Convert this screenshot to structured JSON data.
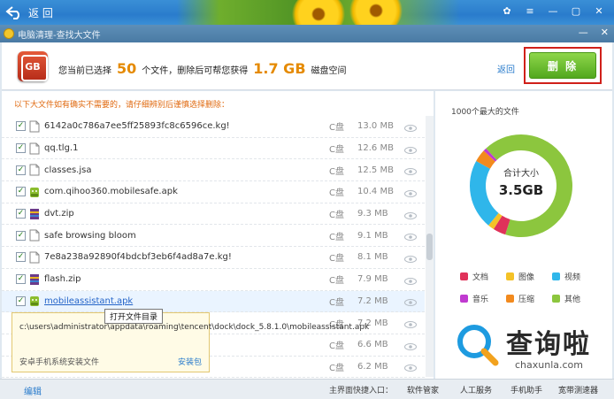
{
  "topbar": {
    "back_label": "返 回"
  },
  "window": {
    "title": "电脑清理-查找大文件"
  },
  "header": {
    "icon_text": "GB",
    "prefix": "您当前已选择",
    "count": "50",
    "middle": "个文件，删除后可帮您获得",
    "size": "1.7 GB",
    "suffix": "磁盘空间",
    "back_link": "返回",
    "delete_label": "删 除"
  },
  "list": {
    "warning": "以下大文件如有确实不需要的，请仔细辨别后谨慎选择删除：",
    "rows": [
      {
        "name": "6142a0c786a7ee5ff25893fc8c6596ce.kg!",
        "drive": "C盘",
        "size": "13.0 MB",
        "icon": "file-icon"
      },
      {
        "name": "qq.tlg.1",
        "drive": "C盘",
        "size": "12.6 MB",
        "icon": "file-icon"
      },
      {
        "name": "classes.jsa",
        "drive": "C盘",
        "size": "12.5 MB",
        "icon": "file-icon"
      },
      {
        "name": "com.qihoo360.mobilesafe.apk",
        "drive": "C盘",
        "size": "10.4 MB",
        "icon": "android-apk-icon"
      },
      {
        "name": "dvt.zip",
        "drive": "C盘",
        "size": "9.3 MB",
        "icon": "zip-archive-icon"
      },
      {
        "name": "safe browsing bloom",
        "drive": "C盘",
        "size": "9.1 MB",
        "icon": "file-icon"
      },
      {
        "name": "7e8a238a92890f4bdcbf3eb6f4ad8a7e.kg!",
        "drive": "C盘",
        "size": "8.1 MB",
        "icon": "file-icon"
      },
      {
        "name": "flash.zip",
        "drive": "C盘",
        "size": "7.9 MB",
        "icon": "zip-archive-icon"
      },
      {
        "name": "mobileassistant.apk",
        "drive": "C盘",
        "size": "7.2 MB",
        "icon": "android-apk-icon"
      },
      {
        "name": "",
        "drive": "C盘",
        "size": "7.2 MB",
        "icon": ""
      },
      {
        "name": "",
        "drive": "C盘",
        "size": "6.6 MB",
        "icon": ""
      },
      {
        "name": "",
        "drive": "C盘",
        "size": "6.2 MB",
        "icon": ""
      }
    ],
    "scroll_position": 0.5
  },
  "tooltip": {
    "text": "打开文件目录"
  },
  "popup": {
    "path": "c:\\users\\administrator\\appdata\\roaming\\tencent\\dock\\dock_5.8.1.0\\mobileassistant.apk",
    "type": "安卓手机系统安装文件",
    "tag": "安装包"
  },
  "right": {
    "title": "1000个最大的文件",
    "total_label": "合计大小",
    "total_value": "3.5GB",
    "legend": [
      {
        "label": "文档",
        "color": "#e0325a"
      },
      {
        "label": "图像",
        "color": "#f4c227"
      },
      {
        "label": "视频",
        "color": "#2fb6ea"
      },
      {
        "label": "音乐",
        "color": "#c03ad0"
      },
      {
        "label": "压缩",
        "color": "#f28a1e"
      },
      {
        "label": "其他",
        "color": "#8cc63e"
      }
    ],
    "donut": [
      {
        "color": "#8cc63e",
        "value": 55
      },
      {
        "color": "#e0325a",
        "value": 4
      },
      {
        "color": "#f4c227",
        "value": 2
      },
      {
        "color": "#2fb6ea",
        "value": 22
      },
      {
        "color": "#f28a1e",
        "value": 4
      },
      {
        "color": "#c03ad0",
        "value": 1
      },
      {
        "color": "#8cc63e",
        "value": 12
      }
    ]
  },
  "watermark": {
    "cn": "查询啦",
    "en": "chaxunla.com"
  },
  "bottom": {
    "edit": "编辑",
    "entry_label": "主界面快捷入口：",
    "links": [
      "软件管家",
      "人工服务",
      "手机助手",
      "宽带测速器"
    ]
  }
}
